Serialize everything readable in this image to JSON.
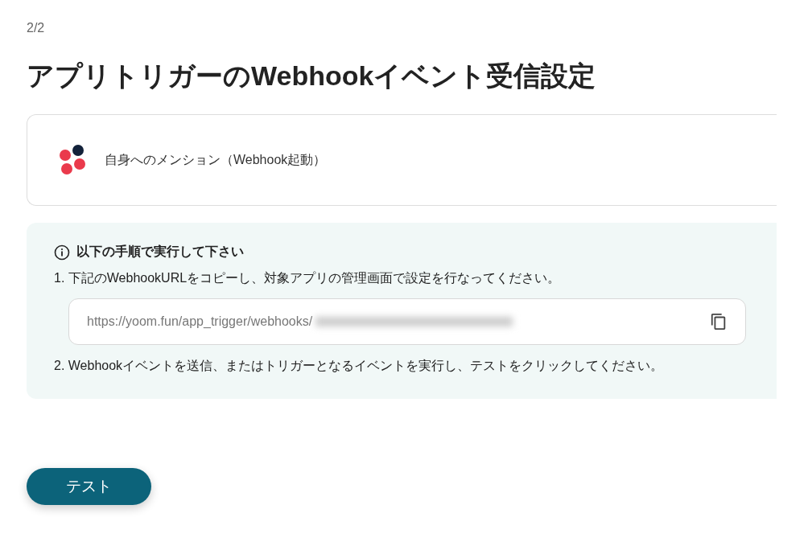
{
  "step": "2/2",
  "title": "アプリトリガーのWebhookイベント受信設定",
  "trigger": {
    "label": "自身へのメンション（Webhook起動）"
  },
  "instructions": {
    "heading": "以下の手順で実行して下さい",
    "steps": [
      {
        "kind": "text",
        "text": "1. 下記のWebhookURLをコピーし、対象アプリの管理画面で設定を行なってください。"
      },
      {
        "kind": "url",
        "value": "https://yoom.fun/app_trigger/webhooks/"
      },
      {
        "kind": "text",
        "text": "2. Webhookイベントを送信、またはトリガーとなるイベントを実行し、テストをクリックしてください。"
      }
    ]
  },
  "button": "テスト"
}
